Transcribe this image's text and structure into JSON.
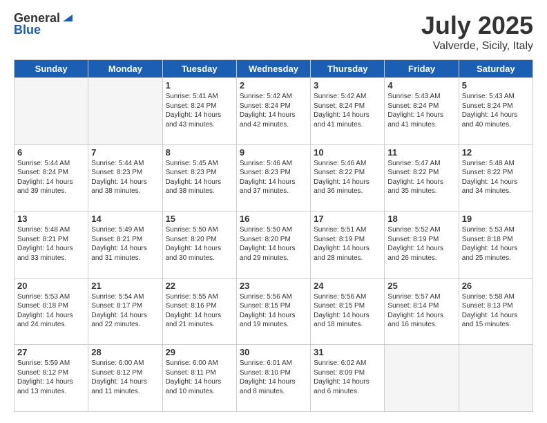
{
  "header": {
    "logo_general": "General",
    "logo_blue": "Blue",
    "month_title": "July 2025",
    "location": "Valverde, Sicily, Italy"
  },
  "weekdays": [
    "Sunday",
    "Monday",
    "Tuesday",
    "Wednesday",
    "Thursday",
    "Friday",
    "Saturday"
  ],
  "weeks": [
    [
      {
        "day": "",
        "empty": true
      },
      {
        "day": "",
        "empty": true
      },
      {
        "day": "1",
        "sunrise": "5:41 AM",
        "sunset": "8:24 PM",
        "daylight": "14 hours and 43 minutes."
      },
      {
        "day": "2",
        "sunrise": "5:42 AM",
        "sunset": "8:24 PM",
        "daylight": "14 hours and 42 minutes."
      },
      {
        "day": "3",
        "sunrise": "5:42 AM",
        "sunset": "8:24 PM",
        "daylight": "14 hours and 41 minutes."
      },
      {
        "day": "4",
        "sunrise": "5:43 AM",
        "sunset": "8:24 PM",
        "daylight": "14 hours and 41 minutes."
      },
      {
        "day": "5",
        "sunrise": "5:43 AM",
        "sunset": "8:24 PM",
        "daylight": "14 hours and 40 minutes."
      }
    ],
    [
      {
        "day": "6",
        "sunrise": "5:44 AM",
        "sunset": "8:24 PM",
        "daylight": "14 hours and 39 minutes."
      },
      {
        "day": "7",
        "sunrise": "5:44 AM",
        "sunset": "8:23 PM",
        "daylight": "14 hours and 38 minutes."
      },
      {
        "day": "8",
        "sunrise": "5:45 AM",
        "sunset": "8:23 PM",
        "daylight": "14 hours and 38 minutes."
      },
      {
        "day": "9",
        "sunrise": "5:46 AM",
        "sunset": "8:23 PM",
        "daylight": "14 hours and 37 minutes."
      },
      {
        "day": "10",
        "sunrise": "5:46 AM",
        "sunset": "8:22 PM",
        "daylight": "14 hours and 36 minutes."
      },
      {
        "day": "11",
        "sunrise": "5:47 AM",
        "sunset": "8:22 PM",
        "daylight": "14 hours and 35 minutes."
      },
      {
        "day": "12",
        "sunrise": "5:48 AM",
        "sunset": "8:22 PM",
        "daylight": "14 hours and 34 minutes."
      }
    ],
    [
      {
        "day": "13",
        "sunrise": "5:48 AM",
        "sunset": "8:21 PM",
        "daylight": "14 hours and 33 minutes."
      },
      {
        "day": "14",
        "sunrise": "5:49 AM",
        "sunset": "8:21 PM",
        "daylight": "14 hours and 31 minutes."
      },
      {
        "day": "15",
        "sunrise": "5:50 AM",
        "sunset": "8:20 PM",
        "daylight": "14 hours and 30 minutes."
      },
      {
        "day": "16",
        "sunrise": "5:50 AM",
        "sunset": "8:20 PM",
        "daylight": "14 hours and 29 minutes."
      },
      {
        "day": "17",
        "sunrise": "5:51 AM",
        "sunset": "8:19 PM",
        "daylight": "14 hours and 28 minutes."
      },
      {
        "day": "18",
        "sunrise": "5:52 AM",
        "sunset": "8:19 PM",
        "daylight": "14 hours and 26 minutes."
      },
      {
        "day": "19",
        "sunrise": "5:53 AM",
        "sunset": "8:18 PM",
        "daylight": "14 hours and 25 minutes."
      }
    ],
    [
      {
        "day": "20",
        "sunrise": "5:53 AM",
        "sunset": "8:18 PM",
        "daylight": "14 hours and 24 minutes."
      },
      {
        "day": "21",
        "sunrise": "5:54 AM",
        "sunset": "8:17 PM",
        "daylight": "14 hours and 22 minutes."
      },
      {
        "day": "22",
        "sunrise": "5:55 AM",
        "sunset": "8:16 PM",
        "daylight": "14 hours and 21 minutes."
      },
      {
        "day": "23",
        "sunrise": "5:56 AM",
        "sunset": "8:15 PM",
        "daylight": "14 hours and 19 minutes."
      },
      {
        "day": "24",
        "sunrise": "5:56 AM",
        "sunset": "8:15 PM",
        "daylight": "14 hours and 18 minutes."
      },
      {
        "day": "25",
        "sunrise": "5:57 AM",
        "sunset": "8:14 PM",
        "daylight": "14 hours and 16 minutes."
      },
      {
        "day": "26",
        "sunrise": "5:58 AM",
        "sunset": "8:13 PM",
        "daylight": "14 hours and 15 minutes."
      }
    ],
    [
      {
        "day": "27",
        "sunrise": "5:59 AM",
        "sunset": "8:12 PM",
        "daylight": "14 hours and 13 minutes."
      },
      {
        "day": "28",
        "sunrise": "6:00 AM",
        "sunset": "8:12 PM",
        "daylight": "14 hours and 11 minutes."
      },
      {
        "day": "29",
        "sunrise": "6:00 AM",
        "sunset": "8:11 PM",
        "daylight": "14 hours and 10 minutes."
      },
      {
        "day": "30",
        "sunrise": "6:01 AM",
        "sunset": "8:10 PM",
        "daylight": "14 hours and 8 minutes."
      },
      {
        "day": "31",
        "sunrise": "6:02 AM",
        "sunset": "8:09 PM",
        "daylight": "14 hours and 6 minutes."
      },
      {
        "day": "",
        "empty": true
      },
      {
        "day": "",
        "empty": true
      }
    ]
  ],
  "labels": {
    "sunrise": "Sunrise:",
    "sunset": "Sunset:",
    "daylight": "Daylight:"
  }
}
